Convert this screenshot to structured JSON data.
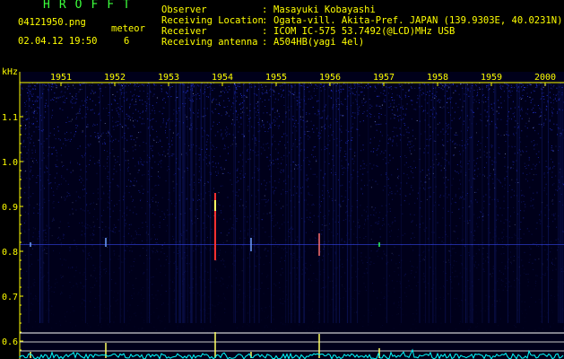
{
  "app": {
    "title": "HROFFT"
  },
  "capture": {
    "file_name": "04121950.png",
    "datetime": "02.04.12 19:50",
    "meteor_label": "meteor",
    "meteor_count": "6"
  },
  "info": [
    {
      "key": "Observer",
      "value": "Masayuki Kobayashi"
    },
    {
      "key": "Receiving Location",
      "value": "Ogata-vill. Akita-Pref. JAPAN (139.9303E, 40.0231N)"
    },
    {
      "key": "Receiver",
      "value": "ICOM IC-575 53.7492(@LCD)MHz USB"
    },
    {
      "key": "Receiving antenna",
      "value": "A504HB(yagi 4el)"
    }
  ],
  "separator": ":",
  "chart_data": {
    "type": "heatmap",
    "ylabel": "kHz",
    "time_ticks": [
      "1951",
      "1952",
      "1953",
      "1954",
      "1955",
      "1956",
      "1957",
      "1958",
      "1959",
      "2000"
    ],
    "freq_ticks": [
      "1.1",
      "1.0",
      "0.9",
      "0.8",
      "0.7",
      "0.6"
    ],
    "carrier_khz": 0.815,
    "meteor_events": [
      {
        "time": "1954",
        "freq_from_khz": 0.78,
        "freq_to_khz": 0.93
      },
      {
        "time": "1956",
        "freq_from_khz": 0.79,
        "freq_to_khz": 0.84
      },
      {
        "time": "1957",
        "freq_from_khz": 0.81,
        "freq_to_khz": 0.82
      },
      {
        "time": "1952",
        "freq_from_khz": 0.81,
        "freq_to_khz": 0.83
      },
      {
        "time": "1955",
        "freq_from_khz": 0.8,
        "freq_to_khz": 0.83
      },
      {
        "time": "1951",
        "freq_from_khz": 0.81,
        "freq_to_khz": 0.82
      }
    ],
    "colors": {
      "background": "#000000",
      "noise": "#2a3cff",
      "ticks": "#ffff00",
      "trace": "#00ffff",
      "guide": "#ffffff",
      "title": "#3cff3c"
    }
  }
}
